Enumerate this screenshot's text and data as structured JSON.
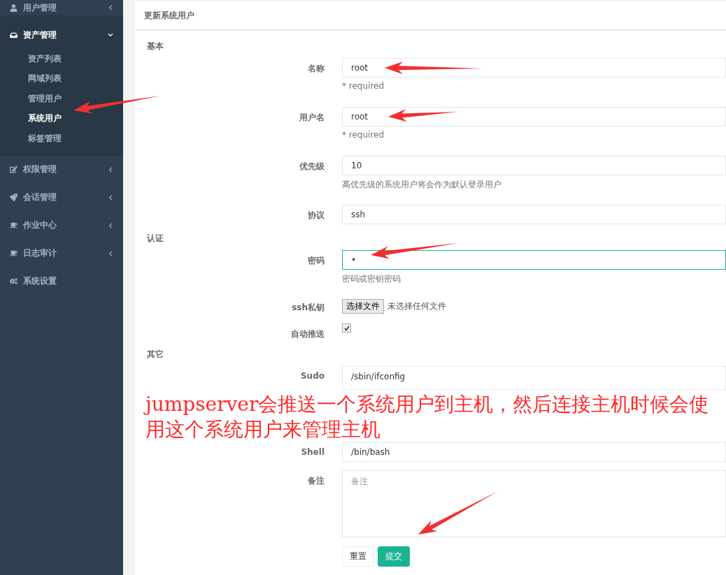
{
  "sidebar": {
    "items": [
      {
        "label": "用户管理",
        "kind": "menu",
        "expanded": false
      },
      {
        "label": "资产管理",
        "kind": "menu",
        "expanded": true,
        "children": [
          {
            "label": "资产列表",
            "selected": false
          },
          {
            "label": "网域列表",
            "selected": false
          },
          {
            "label": "管理用户",
            "selected": false
          },
          {
            "label": "系统用户",
            "selected": true
          },
          {
            "label": "标签管理",
            "selected": false
          }
        ]
      },
      {
        "label": "权限管理",
        "kind": "menu",
        "expanded": false
      },
      {
        "label": "会话管理",
        "kind": "menu",
        "expanded": false
      },
      {
        "label": "作业中心",
        "kind": "menu",
        "expanded": false
      },
      {
        "label": "日志审计",
        "kind": "menu",
        "expanded": false
      },
      {
        "label": "系统设置",
        "kind": "link"
      }
    ]
  },
  "panel": {
    "title": "更新系统用户",
    "sections": [
      {
        "title": "基本",
        "fields": [
          {
            "label": "名称",
            "kind": "text",
            "value": "root",
            "help": "* required",
            "focused": false
          },
          {
            "label": "用户名",
            "kind": "text",
            "value": "root",
            "help": "* required",
            "focused": false
          },
          {
            "label": "优先级",
            "kind": "text",
            "value": "10",
            "help": "高优先级的系统用户将会作为默认登录用户",
            "focused": false
          },
          {
            "label": "协议",
            "kind": "text",
            "value": "ssh",
            "focused": false
          }
        ]
      },
      {
        "title": "认证",
        "fields": [
          {
            "label": "密码",
            "kind": "text",
            "value": "•",
            "help": "密码或密钥密码",
            "focused": true
          },
          {
            "label": "ssh私钥",
            "kind": "file",
            "button": "选择文件",
            "status": "未选择任何文件"
          },
          {
            "label": "自动推送",
            "kind": "checkbox",
            "checked": true
          }
        ]
      },
      {
        "title": "其它",
        "fields": [
          {
            "label": "Sudo",
            "kind": "textarea",
            "value": "/sbin/ifconfig"
          },
          {
            "label": "Shell",
            "kind": "text",
            "value": "/bin/bash",
            "focused": false
          },
          {
            "label": "备注",
            "kind": "textarea",
            "placeholder": "备注"
          }
        ]
      }
    ],
    "buttons": [
      {
        "label": "重置",
        "kind": "default"
      },
      {
        "label": "提交",
        "kind": "primary"
      }
    ]
  },
  "annotation": {
    "text": "jumpserver会推送一个系统用户到主机，然后连接主机时候会使用这个系统用户来管理主机"
  }
}
